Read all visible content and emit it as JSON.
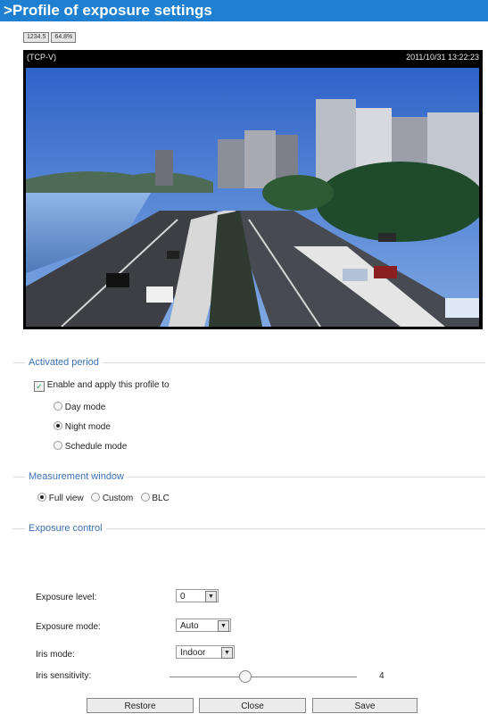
{
  "title": ">Profile of exposure settings",
  "toolbar": {
    "btn1": "1234.5",
    "btn2": "64.8%"
  },
  "viewer": {
    "stream": "(TCP-V)",
    "timestamp": "2011/10/31 13:22:23"
  },
  "activated_period": {
    "legend": "Activated period",
    "enable_label": "Enable and apply this profile to",
    "enable_checked": true,
    "modes": [
      {
        "label": "Day mode",
        "selected": false
      },
      {
        "label": "Night mode",
        "selected": true
      },
      {
        "label": "Schedule mode",
        "selected": false
      }
    ]
  },
  "measurement_window": {
    "legend": "Measurement window",
    "options": [
      {
        "label": "Full view",
        "selected": true
      },
      {
        "label": "Custom",
        "selected": false
      },
      {
        "label": "BLC",
        "selected": false
      }
    ]
  },
  "exposure_control": {
    "legend": "Exposure control",
    "level_label": "Exposure level:",
    "level_value": "0",
    "mode_label": "Exposure mode:",
    "mode_value": "Auto",
    "iris_label": "Iris mode:",
    "iris_value": "Indoor",
    "sensitivity_label": "Iris sensitivity:",
    "sensitivity_value": "4",
    "sensitivity_fraction": 0.4
  },
  "buttons": {
    "restore": "Restore",
    "close": "Close",
    "save": "Save"
  },
  "colors": {
    "title_bar": "#1f7fd0",
    "legend_text": "#3a6fb4"
  }
}
